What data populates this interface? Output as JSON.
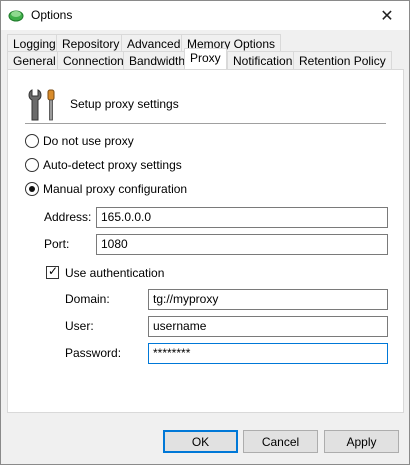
{
  "window": {
    "title": "Options"
  },
  "tabs": {
    "row1": [
      "Logging",
      "Repository",
      "Advanced",
      "Memory Options"
    ],
    "row2": [
      "General",
      "Connection",
      "Bandwidth",
      "Proxy",
      "Notification",
      "Retention Policy"
    ],
    "active": "Proxy"
  },
  "header": {
    "text": "Setup proxy settings"
  },
  "proxy_options": [
    {
      "label": "Do not use proxy",
      "checked": false
    },
    {
      "label": "Auto-detect proxy settings",
      "checked": false
    },
    {
      "label": "Manual proxy configuration",
      "checked": true
    }
  ],
  "address": {
    "label": "Address:",
    "value": "165.0.0.0"
  },
  "port": {
    "label": "Port:",
    "value": "1080"
  },
  "auth": {
    "label": "Use authentication",
    "checked": true
  },
  "domain": {
    "label": "Domain:",
    "value": "tg://myproxy"
  },
  "user": {
    "label": "User:",
    "value": "username"
  },
  "password": {
    "label": "Password:",
    "value": "********"
  },
  "buttons": {
    "ok": "OK",
    "cancel": "Cancel",
    "apply": "Apply"
  },
  "colors": {
    "focus": "#0078d7",
    "panel": "#ffffff",
    "chrome": "#f0f0f0"
  }
}
